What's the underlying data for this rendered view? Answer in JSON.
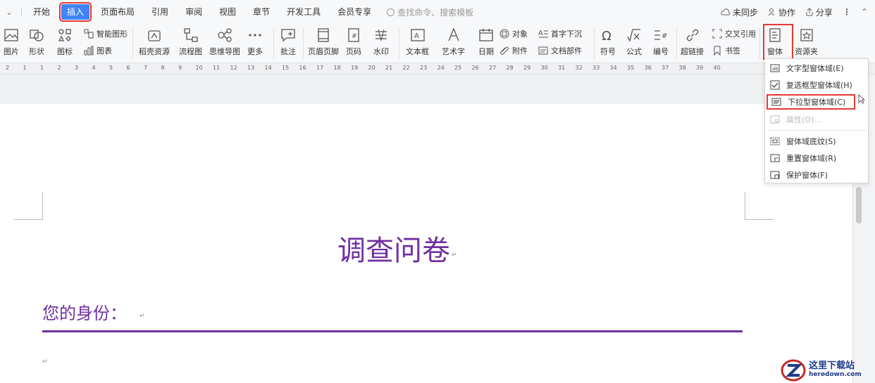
{
  "menubar": {
    "tabs": [
      "开始",
      "插入",
      "页面布局",
      "引用",
      "审阅",
      "视图",
      "章节",
      "开发工具",
      "会员专享"
    ],
    "active_tab": "插入",
    "search_placeholder": "查找命令、搜索模板",
    "unsync": "未同步",
    "collab": "协作",
    "share": "分享"
  },
  "ribbon": {
    "picture": "图片",
    "shape": "形状",
    "icon_lib": "图标",
    "smart_shape": "智能图形",
    "chart": "图表",
    "shell_resource": "稻壳资源",
    "flowchart": "流程图",
    "mindmap": "思维导图",
    "more": "更多",
    "comment": "批注",
    "header_footer": "页眉页脚",
    "page_num": "页码",
    "watermark": "水印",
    "textbox": "文本框",
    "wordart": "艺术字",
    "date": "日期",
    "object": "对象",
    "attachment": "附件",
    "drop_cap": "首字下沉",
    "doc_parts": "文档部件",
    "symbol": "符号",
    "formula": "公式",
    "numbering": "编号",
    "hyperlink": "超链接",
    "cross_ref": "交叉引用",
    "bookmark": "书签",
    "form": "窗体",
    "resources": "资源夹"
  },
  "ruler_numbers": [
    "2",
    "1",
    "1",
    "2",
    "3",
    "4",
    "5",
    "6",
    "7",
    "8",
    "9",
    "10",
    "11",
    "12",
    "13",
    "14",
    "15",
    "16",
    "17",
    "18",
    "19",
    "20",
    "21",
    "22",
    "23",
    "24",
    "25",
    "26",
    "27",
    "28",
    "29",
    "30",
    "31",
    "32",
    "33",
    "34",
    "35",
    "36",
    "37",
    "38",
    "39",
    "40"
  ],
  "dropdown": {
    "items": [
      {
        "label": "文字型窗体域(E)"
      },
      {
        "label": "复选框型窗体域(H)"
      },
      {
        "label": "下拉型窗体域(C)"
      },
      {
        "label": "属性(O)..."
      },
      {
        "label": "窗体域底纹(S)"
      },
      {
        "label": "重置窗体域(R)"
      },
      {
        "label": "保护窗体(F)"
      }
    ]
  },
  "document": {
    "title": "调查问卷",
    "heading": "您的身份：",
    "title_color": "#7030a0"
  },
  "watermark": {
    "line1": "这里下载站",
    "line2": "heredown.com"
  }
}
